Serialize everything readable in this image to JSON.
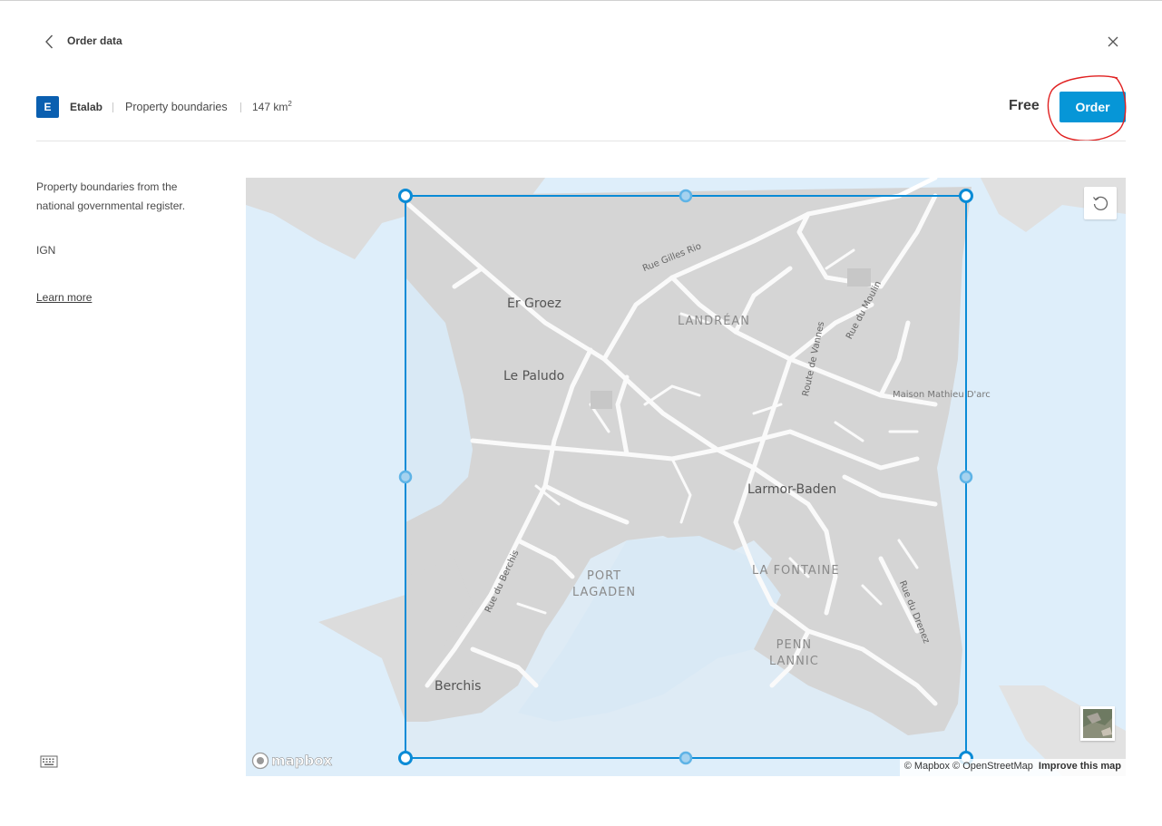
{
  "header": {
    "title": "Order data"
  },
  "product": {
    "provider_initial": "E",
    "provider": "Etalab",
    "name": "Property boundaries",
    "area_value": "147 km",
    "area_unit_sup": "2",
    "price": "Free",
    "order_label": "Order"
  },
  "details": {
    "description": "Property boundaries from the national governmental register.",
    "source": "IGN",
    "learn_more": "Learn more"
  },
  "map": {
    "labels": {
      "er_groez": "Er Groez",
      "le_paludo": "Le Paludo",
      "landrean": "LANDRÉAN",
      "larmor_baden": "Larmor-Baden",
      "port_lagaden_1": "PORT",
      "port_lagaden_2": "LAGADEN",
      "la_fontaine": "LA FONTAINE",
      "penn_lannic_1": "PENN",
      "penn_lannic_2": "LANNIC",
      "berchis": "Berchis",
      "maison_mathieu": "Maison Mathieu D'arc",
      "rue_gilles_rio": "Rue Gilles Rio",
      "route_de_vannes": "Route de Vannes",
      "rue_du_moulin": "Rue du Moulin",
      "rue_du_berchis": "Rue du Berchis",
      "rue_du_drenez": "Rue du Drenez"
    },
    "logo": "mapbox",
    "attribution": "© Mapbox © OpenStreetMap",
    "improve": "Improve this map",
    "colors": {
      "water": "#d9ecf9",
      "land": "#d6d6d6",
      "road": "#ffffff",
      "selection": "#0a8bd6"
    }
  },
  "annotation": {
    "color": "#e02020"
  }
}
